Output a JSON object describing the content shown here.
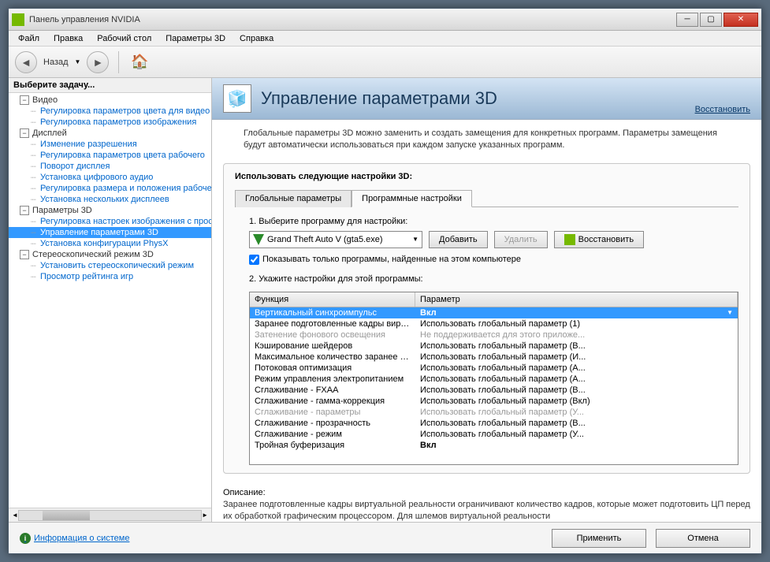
{
  "window": {
    "title": "Панель управления NVIDIA"
  },
  "menu": [
    "Файл",
    "Правка",
    "Рабочий стол",
    "Параметры 3D",
    "Справка"
  ],
  "nav": {
    "back": "Назад"
  },
  "sidebar": {
    "title": "Выберите задачу...",
    "groups": [
      {
        "label": "Видео",
        "items": [
          "Регулировка параметров цвета для видео",
          "Регулировка параметров изображения"
        ]
      },
      {
        "label": "Дисплей",
        "items": [
          "Изменение разрешения",
          "Регулировка параметров цвета рабочего",
          "Поворот дисплея",
          "Установка цифрового аудио",
          "Регулировка размера и положения рабочего",
          "Установка нескольких дисплеев"
        ]
      },
      {
        "label": "Параметры 3D",
        "items": [
          "Регулировка настроек изображения с просмотром",
          "Управление параметрами 3D",
          "Установка конфигурации PhysX"
        ],
        "selected": 1
      },
      {
        "label": "Стереоскопический режим 3D",
        "items": [
          "Установить стереоскопический режим",
          "Просмотр рейтинга игр"
        ]
      }
    ]
  },
  "hero": {
    "title": "Управление параметрами 3D",
    "restore": "Восстановить",
    "desc": "Глобальные параметры 3D можно заменить и создать замещения для конкретных программ. Параметры замещения будут автоматически использоваться при каждом запуске указанных программ."
  },
  "settings": {
    "heading": "Использовать следующие настройки 3D:",
    "tabs": [
      "Глобальные параметры",
      "Программные настройки"
    ],
    "activeTab": 1,
    "step1": "1. Выберите программу для настройки:",
    "program": "Grand Theft Auto V (gta5.exe)",
    "add": "Добавить",
    "remove": "Удалить",
    "restore": "Восстановить",
    "showOnly": "Показывать только программы, найденные на этом компьютере",
    "step2": "2. Укажите настройки для этой программы:",
    "columns": {
      "func": "Функция",
      "param": "Параметр"
    },
    "rows": [
      {
        "f": "Вертикальный синхроимпульс",
        "p": "Вкл",
        "sel": true
      },
      {
        "f": "Заранее подготовленные кадры вирту...",
        "p": "Использовать глобальный параметр (1)"
      },
      {
        "f": "Затенение фонового освещения",
        "p": "Не поддерживается для этого приложе...",
        "dis": true
      },
      {
        "f": "Кэширование шейдеров",
        "p": "Использовать глобальный параметр (В..."
      },
      {
        "f": "Максимальное количество заранее под...",
        "p": "Использовать глобальный параметр (И..."
      },
      {
        "f": "Потоковая оптимизация",
        "p": "Использовать глобальный параметр (А..."
      },
      {
        "f": "Режим управления электропитанием",
        "p": "Использовать глобальный параметр (А..."
      },
      {
        "f": "Сглаживание - FXAA",
        "p": "Использовать глобальный параметр (В..."
      },
      {
        "f": "Сглаживание - гамма-коррекция",
        "p": "Использовать глобальный параметр (Вкл)"
      },
      {
        "f": "Сглаживание - параметры",
        "p": "Использовать глобальный параметр (У...",
        "dis": true
      },
      {
        "f": "Сглаживание - прозрачность",
        "p": "Использовать глобальный параметр (В..."
      },
      {
        "f": "Сглаживание - режим",
        "p": "Использовать глобальный параметр (У..."
      },
      {
        "f": "Тройная буферизация",
        "p": "Вкл",
        "bold": true
      }
    ]
  },
  "description": {
    "title": "Описание:",
    "text": "Заранее подготовленные кадры виртуальной реальности ограничивают количество кадров, которые может подготовить ЦП перед их обработкой графическим процессором. Для шлемов виртуальной реальности"
  },
  "footer": {
    "info": "Информация о системе",
    "apply": "Применить",
    "cancel": "Отмена"
  }
}
